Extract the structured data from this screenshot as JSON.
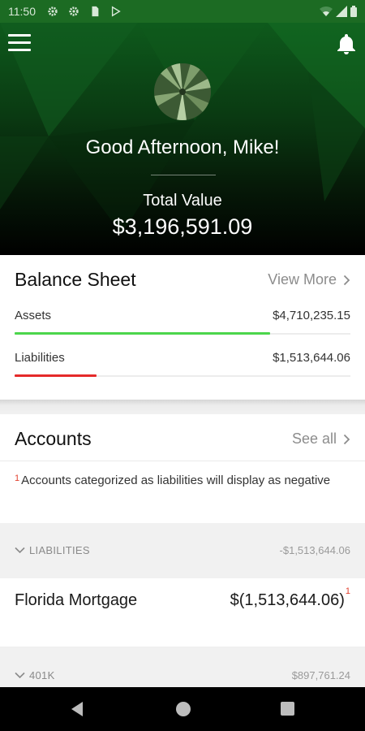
{
  "status_bar": {
    "time": "11:50",
    "icons": [
      "settings-icon",
      "settings-icon",
      "sd-card-icon",
      "play-store-icon",
      "wifi-icon",
      "signal-icon",
      "battery-icon"
    ]
  },
  "header": {
    "menu_icon": "hamburger-menu-icon",
    "notification_icon": "bell-icon",
    "greeting": "Good Afternoon, Mike!",
    "total_label": "Total Value",
    "total_value": "$3,196,591.09"
  },
  "balance_sheet": {
    "title": "Balance Sheet",
    "view_more": "View More",
    "assets": {
      "label": "Assets",
      "value": "$4,710,235.15",
      "bar_fraction": 0.76,
      "color": "#4cd64c"
    },
    "liabilities": {
      "label": "Liabilities",
      "value": "$1,513,644.06",
      "bar_fraction": 0.245,
      "color": "#e52a2a"
    }
  },
  "accounts": {
    "title": "Accounts",
    "see_all": "See all",
    "note_marker": "1",
    "note": "Accounts categorized as liabilities will display as negative",
    "groups": [
      {
        "label": "LIABILITIES",
        "total": "-$1,513,644.06"
      },
      {
        "label": "401K",
        "total": "$897,761.24"
      }
    ],
    "items": [
      {
        "name": "Florida Mortgage",
        "value": "$(1,513,644.06)",
        "marker": "1"
      }
    ]
  },
  "nav_bar": {
    "buttons": [
      "back-icon",
      "home-icon",
      "recents-icon"
    ]
  }
}
